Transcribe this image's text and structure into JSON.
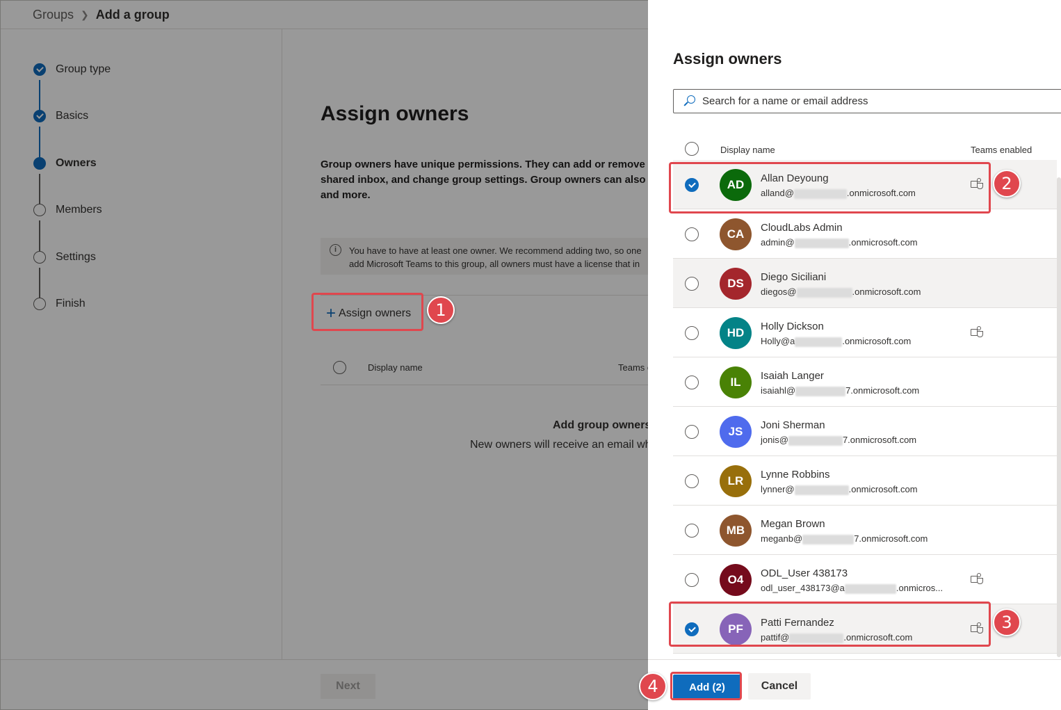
{
  "breadcrumb": {
    "root": "Groups",
    "current": "Add a group"
  },
  "steps": [
    {
      "label": "Group type",
      "state": "done"
    },
    {
      "label": "Basics",
      "state": "done"
    },
    {
      "label": "Owners",
      "state": "current"
    },
    {
      "label": "Members",
      "state": "todo"
    },
    {
      "label": "Settings",
      "state": "todo"
    },
    {
      "label": "Finish",
      "state": "todo"
    }
  ],
  "main": {
    "title": "Assign owners",
    "desc_line1": "Group owners have unique permissions. They can add or remove",
    "desc_line2": "shared inbox, and change group settings. Group owners can also",
    "desc_line3": "and more.",
    "info_line1": "You have to have at least one owner. We recommend adding two, so one",
    "info_line2": "add Microsoft Teams to this group, all owners must have a license that in",
    "assign_button": "Assign owners",
    "col_display_name": "Display name",
    "col_teams": "Teams enabled",
    "empty_title": "Add group owners",
    "empty_sub": "New owners will receive an email when",
    "next_button": "Next"
  },
  "panel": {
    "title": "Assign owners",
    "search_placeholder": "Search for a name or email address",
    "col_display_name": "Display name",
    "col_teams": "Teams enabled",
    "add_button": "Add (2)",
    "cancel_button": "Cancel"
  },
  "users": [
    {
      "initials": "AD",
      "name": "Allan Deyoung",
      "email_prefix": "alland@",
      "email_suffix": ".onmicrosoft.com",
      "color": "#0b6a0b",
      "checked": true,
      "teams": true
    },
    {
      "initials": "CA",
      "name": "CloudLabs Admin",
      "email_prefix": "admin@",
      "email_suffix": ".onmicrosoft.com",
      "color": "#8e562e",
      "checked": false,
      "teams": false
    },
    {
      "initials": "DS",
      "name": "Diego Siciliani",
      "email_prefix": "diegos@",
      "email_suffix": ".onmicrosoft.com",
      "color": "#a4262c",
      "checked": false,
      "teams": false
    },
    {
      "initials": "HD",
      "name": "Holly Dickson",
      "email_prefix": "Holly@a",
      "email_suffix": ".onmicrosoft.com",
      "color": "#038387",
      "checked": false,
      "teams": true
    },
    {
      "initials": "IL",
      "name": "Isaiah Langer",
      "email_prefix": "isaiahl@",
      "email_suffix": "7.onmicrosoft.com",
      "color": "#498205",
      "checked": false,
      "teams": false
    },
    {
      "initials": "JS",
      "name": "Joni Sherman",
      "email_prefix": "jonis@",
      "email_suffix": "7.onmicrosoft.com",
      "color": "#4f6bed",
      "checked": false,
      "teams": false
    },
    {
      "initials": "LR",
      "name": "Lynne Robbins",
      "email_prefix": "lynner@",
      "email_suffix": ".onmicrosoft.com",
      "color": "#986f0b",
      "checked": false,
      "teams": false
    },
    {
      "initials": "MB",
      "name": "Megan Brown",
      "email_prefix": "meganb@",
      "email_suffix": "7.onmicrosoft.com",
      "color": "#8e562e",
      "checked": false,
      "teams": false
    },
    {
      "initials": "O4",
      "name": "ODL_User 438173",
      "email_prefix": "odl_user_438173@a",
      "email_suffix": ".onmicros...",
      "color": "#750b1c",
      "checked": false,
      "teams": true
    },
    {
      "initials": "PF",
      "name": "Patti Fernandez",
      "email_prefix": "pattif@",
      "email_suffix": ".onmicrosoft.com",
      "color": "#8764b8",
      "checked": true,
      "teams": true
    }
  ],
  "annotations": [
    "1",
    "2",
    "3",
    "4"
  ],
  "colors": {
    "accent": "#0f6cbd",
    "highlight": "#e0474e"
  }
}
